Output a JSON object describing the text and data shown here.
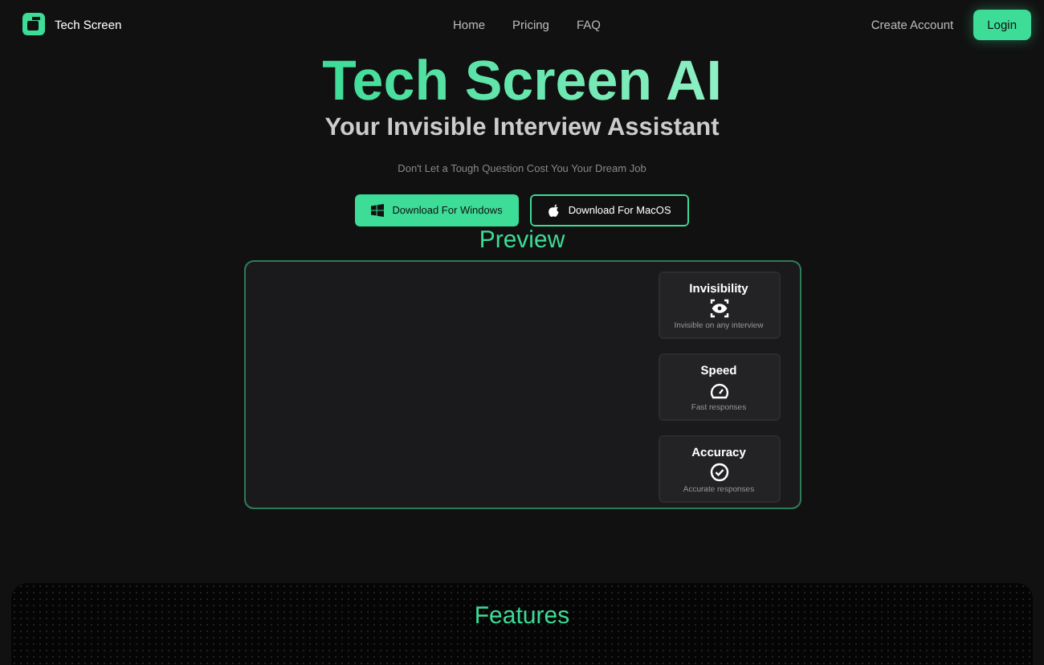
{
  "nav": {
    "brand": "Tech Screen",
    "links": [
      "Home",
      "Pricing",
      "FAQ"
    ],
    "create_account": "Create Account",
    "login": "Login"
  },
  "hero": {
    "title": "Tech Screen AI",
    "subtitle": "Your Invisible Interview Assistant",
    "tagline": "Don't Let a Tough Question Cost You Your Dream Job",
    "buttons": [
      {
        "label": "Download For Windows",
        "kind": "windows"
      },
      {
        "label": "Download For MacOS",
        "kind": "apple"
      }
    ]
  },
  "preview": {
    "heading": "Preview",
    "cards": [
      {
        "title": "Invisibility",
        "kind": "eye",
        "caption": "Invisible on any interview"
      },
      {
        "title": "Speed",
        "kind": "gauge",
        "caption": "Fast responses"
      },
      {
        "title": "Accuracy",
        "kind": "check",
        "caption": "Accurate responses"
      }
    ]
  },
  "features": {
    "heading": "Features"
  }
}
